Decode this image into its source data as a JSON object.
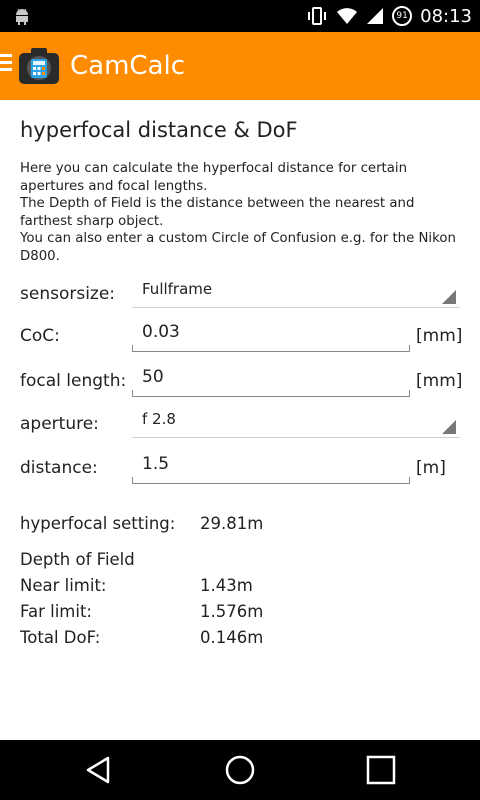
{
  "status_bar": {
    "time": "08:13",
    "battery_level": "91",
    "icons": [
      "android-icon",
      "vibrate-icon",
      "wifi-icon",
      "signal-icon",
      "battery-icon"
    ]
  },
  "app_bar": {
    "title": "CamCalc",
    "accent_color": "#ff8c00"
  },
  "main": {
    "title": "hyperfocal distance & DoF",
    "description_lines": [
      "Here you can calculate the hyperfocal distance for certain",
      "apertures and focal lengths.",
      "The Depth of Field is the distance between the nearest and",
      "farthest sharp object.",
      "You can also enter a custom Circle of Confusion e.g. for the Nikon",
      "D800."
    ],
    "sensorsize": {
      "label": "sensorsize:",
      "value": "Fullframe"
    },
    "coc": {
      "label": "CoC:",
      "value": "0.03",
      "unit": "[mm]"
    },
    "focal_length": {
      "label": "focal length:",
      "value": "50",
      "unit": "[mm]"
    },
    "aperture": {
      "label": "aperture:",
      "value": "f 2.8"
    },
    "distance": {
      "label": "distance:",
      "value": "1.5",
      "unit": "[m]"
    }
  },
  "results": {
    "hyperfocal_label": "hyperfocal setting:",
    "hyperfocal_value": "29.81m",
    "dof_title": "Depth of Field",
    "near_label": "Near limit:",
    "near_value": "1.43m",
    "far_label": "Far limit:",
    "far_value": "1.576m",
    "total_label": "Total DoF:",
    "total_value": "0.146m"
  },
  "nav_bar": {
    "icons": [
      "back-icon",
      "home-icon",
      "recents-icon"
    ]
  }
}
